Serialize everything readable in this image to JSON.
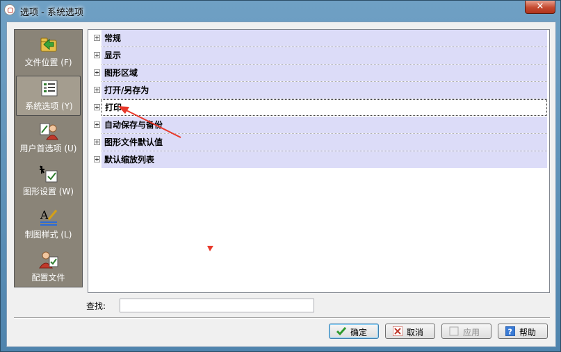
{
  "window": {
    "title": "选项 - 系统选项",
    "close_label": "✕"
  },
  "sidebar": {
    "items": [
      {
        "label": "文件位置 (F)",
        "icon": "folder-arrow-icon"
      },
      {
        "label": "系统选项 (Y)",
        "icon": "system-list-icon",
        "active": true
      },
      {
        "label": "用户首选项 (U)",
        "icon": "user-preferences-icon"
      },
      {
        "label": "图形设置 (W)",
        "icon": "graphics-settings-icon"
      },
      {
        "label": "制图样式 (L)",
        "icon": "drafting-style-icon"
      },
      {
        "label": "配置文件",
        "icon": "profile-icon"
      }
    ]
  },
  "tree": {
    "items": [
      {
        "label": "常规"
      },
      {
        "label": "显示"
      },
      {
        "label": "图形区域"
      },
      {
        "label": "打开/另存为"
      },
      {
        "label": "打印",
        "selected": true
      },
      {
        "label": "自动保存与备份"
      },
      {
        "label": "图形文件默认值"
      },
      {
        "label": "默认缩放列表"
      }
    ]
  },
  "search": {
    "label": "查找:",
    "value": "",
    "placeholder": ""
  },
  "buttons": {
    "ok": "确定",
    "cancel": "取消",
    "apply": "应用",
    "help": "帮助"
  },
  "colors": {
    "row_highlight": "#dcdcf8",
    "sidebar_bg": "#8a8478",
    "annotation_arrow": "#e8392b"
  }
}
